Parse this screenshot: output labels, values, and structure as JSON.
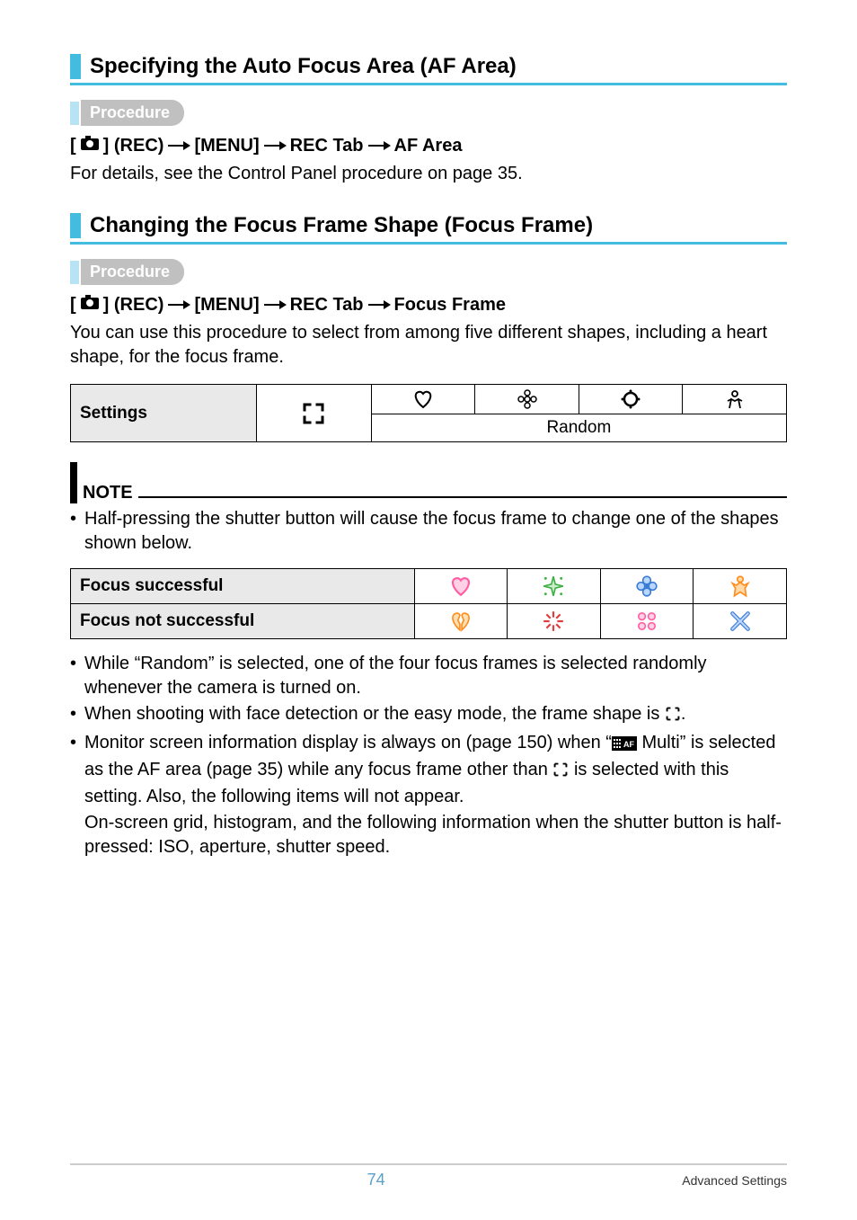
{
  "section1": {
    "title": "Specifying the Auto Focus Area (AF Area)",
    "procedure_label": "Procedure",
    "path": [
      "[",
      "] (REC)",
      "[MENU]",
      "REC Tab",
      "AF Area"
    ],
    "body": "For details, see the Control Panel procedure on page 35."
  },
  "section2": {
    "title": "Changing the Focus Frame Shape (Focus Frame)",
    "procedure_label": "Procedure",
    "path": [
      "[",
      "] (REC)",
      "[MENU]",
      "REC Tab",
      "Focus Frame"
    ],
    "body": "You can use this procedure to select from among five different shapes, including a heart shape, for the focus frame."
  },
  "settings": {
    "label": "Settings",
    "random": "Random"
  },
  "note": {
    "label": "NOTE",
    "bullet1": "Half-pressing the shutter button will cause the focus frame to change one of the shapes shown below."
  },
  "focus": {
    "row1": "Focus successful",
    "row2": "Focus not successful"
  },
  "bullets2": {
    "b1": "While “Random” is selected, one of the four focus frames is selected randomly whenever the camera is turned on.",
    "b2_a": "When shooting with face detection or the easy mode, the frame shape is ",
    "b2_b": ".",
    "b3_a": "Monitor screen information display is always on (page 150) when “",
    "b3_b": " Multi” is selected as the AF area (page 35) while any focus frame other than ",
    "b3_c": " is selected with this setting. Also, the following items will not appear.",
    "b3_after": "On-screen grid, histogram, and the following information when the shutter button is half-pressed: ISO, aperture, shutter speed."
  },
  "footer": {
    "page": "74",
    "chapter": "Advanced Settings"
  }
}
